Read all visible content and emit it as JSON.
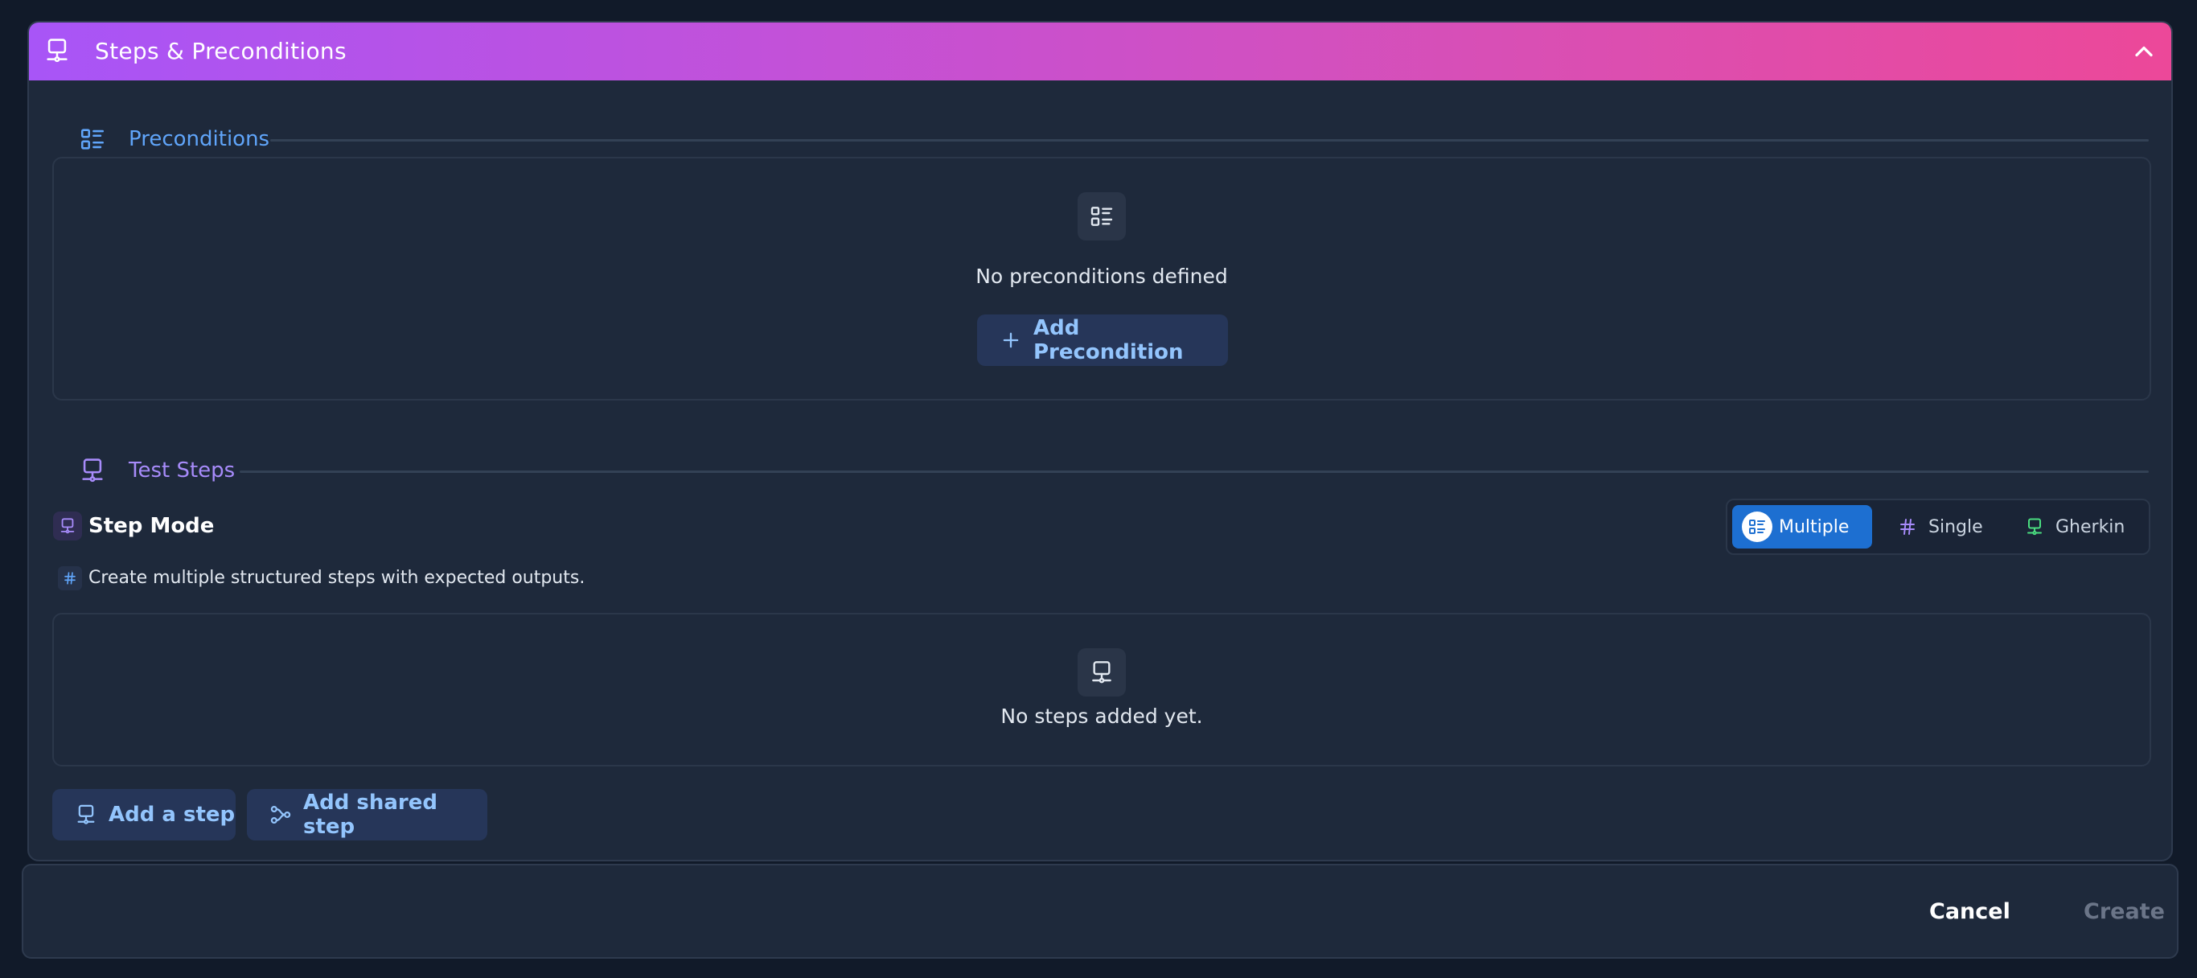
{
  "panel": {
    "title": "Steps & Preconditions",
    "header_gradient": [
      "#a855f7",
      "#ec4899"
    ],
    "icon": "step-icon",
    "collapse_icon": "chevron-up-icon"
  },
  "preconditions": {
    "section_label": "Preconditions",
    "section_icon": "list-icon",
    "accent": "#60a5fa",
    "empty_text": "No preconditions defined",
    "add_button_label": "Add Precondition",
    "add_button_icon": "plus-icon"
  },
  "test_steps": {
    "section_label": "Test Steps",
    "section_icon": "step-icon",
    "accent": "#a78bfa",
    "step_mode_label": "Step Mode",
    "modes": [
      {
        "label": "Multiple",
        "icon": "list-icon",
        "selected": true
      },
      {
        "label": "Single",
        "icon": "hash-icon",
        "selected": false
      },
      {
        "label": "Gherkin",
        "icon": "step-icon",
        "selected": false
      }
    ],
    "mode_description": "Create multiple structured steps with expected outputs.",
    "empty_text": "No steps added yet.",
    "add_step_label": "Add a step",
    "add_shared_step_label": "Add shared step"
  },
  "footer": {
    "cancel_label": "Cancel",
    "create_label": "Create"
  }
}
